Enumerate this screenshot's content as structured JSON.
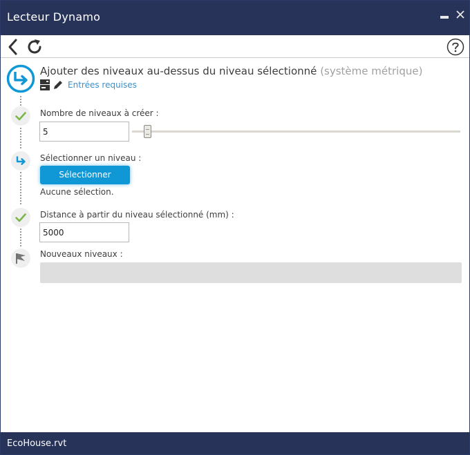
{
  "window": {
    "title": "Lecteur Dynamo",
    "colors": {
      "titlebar": "#283359",
      "accent": "#1097d6",
      "link": "#3b8fc9",
      "check": "#7ab648"
    }
  },
  "toolbar": {
    "back_icon": "chevron-left-icon",
    "refresh_icon": "refresh-icon",
    "help_icon": "help-icon"
  },
  "header": {
    "title": "Ajouter des niveaux au-dessus du niveau sélectionné",
    "title_suffix": "(système métrique)",
    "inputs_link": "Entrées requises"
  },
  "steps": {
    "levels_count": {
      "label": "Nombre de niveaux à créer :",
      "value": "5",
      "status": "complete"
    },
    "select_level": {
      "label": "Sélectionner un niveau :",
      "button_label": "Sélectionner",
      "selection_text": "Aucune sélection.",
      "status": "pending"
    },
    "distance": {
      "label": "Distance à partir du niveau sélectionné (mm) :",
      "value": "5000",
      "status": "complete"
    },
    "new_levels": {
      "label": "Nouveaux niveaux :",
      "status": "output"
    }
  },
  "statusbar": {
    "file": "EcoHouse.rvt"
  }
}
